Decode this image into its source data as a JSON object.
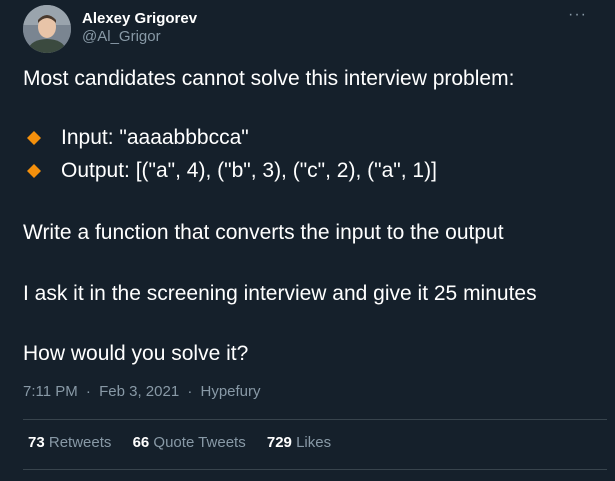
{
  "author": {
    "name": "Alexey Grigorev",
    "handle": "@Al_Grigor"
  },
  "more_menu": "···",
  "tweet": {
    "intro": "Most candidates cannot solve this interview problem:",
    "bullets": [
      "Input: \"aaaabbbcca\"",
      "Output: [(\"a\", 4), (\"b\", 3), (\"c\", 2), (\"a\", 1)]"
    ],
    "task": "Write a function that converts the input to the output",
    "context": "I ask it in the screening interview and give it 25 minutes",
    "question": "How would you solve it?"
  },
  "meta": {
    "time": "7:11 PM",
    "separator": "·",
    "date": "Feb 3, 2021",
    "source": "Hypefury"
  },
  "stats": {
    "retweets_count": "73",
    "retweets_label": "Retweets",
    "quotes_count": "66",
    "quotes_label": "Quote Tweets",
    "likes_count": "729",
    "likes_label": "Likes"
  },
  "colors": {
    "background": "#15202b",
    "text": "#ffffff",
    "secondary": "#8899a6",
    "bullet": "#f4900c",
    "divider": "#38444d"
  },
  "icons": {
    "bullet": "orange-diamond-icon",
    "more": "more-dots-icon"
  }
}
